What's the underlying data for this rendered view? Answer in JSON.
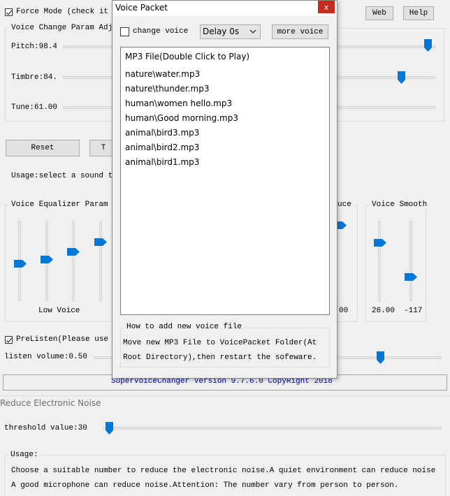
{
  "main": {
    "force_mode_label": "Force Mode (check it",
    "web_button": "Web",
    "help_button": "Help",
    "param_group_title": "Voice Change Param Adj",
    "pitch_label": "Pitch:98.4",
    "timbre_label": "Timbre:84.",
    "tune_label": "Tune:61.00",
    "reset_button": "Reset",
    "second_button_fragment": "T",
    "usage_text": "Usage:select a sound t",
    "equalizer_title": "Voice Equalizer Param",
    "low_voice_label": "Low Voice",
    "reduce_title_fragment": "uce",
    "reduce_value_fragment": "00",
    "smooth_title": "Voice Smooth",
    "smooth_value1": "26.00",
    "smooth_value2": "-117",
    "prelisten_label": "PreListen(Please use",
    "listen_volume_label": "listen volume:0.50",
    "status_text": "SuperVoiceChanger Version 9.7.6.0 CopyRight 2018"
  },
  "voice_packet": {
    "title": "Voice Packet",
    "close_glyph": "x",
    "change_voice_label": "change voice",
    "delay_selected": "Delay 0s",
    "more_voice_button": "more voice",
    "list_header": "MP3 File(Double Click to Play)",
    "files": [
      "nature\\water.mp3",
      "nature\\thunder.mp3",
      "human\\women hello.mp3",
      "human\\Good morning.mp3",
      "animal\\bird3.mp3",
      "animal\\bird2.mp3",
      "animal\\bird1.mp3"
    ],
    "howto_title": "How to add new voice file",
    "howto_line1": "Move new MP3 File to VoicePacket Folder(At",
    "howto_line2": "Root Directory),then restart the sofeware."
  },
  "noise": {
    "title": "Reduce Electronic Noise",
    "threshold_label": "threshold value:30",
    "usage_title": "Usage:",
    "usage_line1": "Choose a suitable number to reduce the electronic noise.A quiet environment can reduce noise",
    "usage_line2": "A good microphone can reduce noise.Attention: The number vary from person to person."
  },
  "colors": {
    "thumb": "#0078d7",
    "close": "#c42b1c",
    "status_text": "#0000aa"
  }
}
